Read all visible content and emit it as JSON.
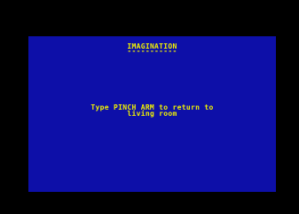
{
  "screen": {
    "title": "IMAGINATION",
    "title_underline": "-----------",
    "message_line1": "Type PINCH ARM to return to",
    "message_line2": "living room"
  },
  "colors": {
    "border": "#000000",
    "screen_background": "#0d0fa8",
    "text": "#f2f200"
  }
}
